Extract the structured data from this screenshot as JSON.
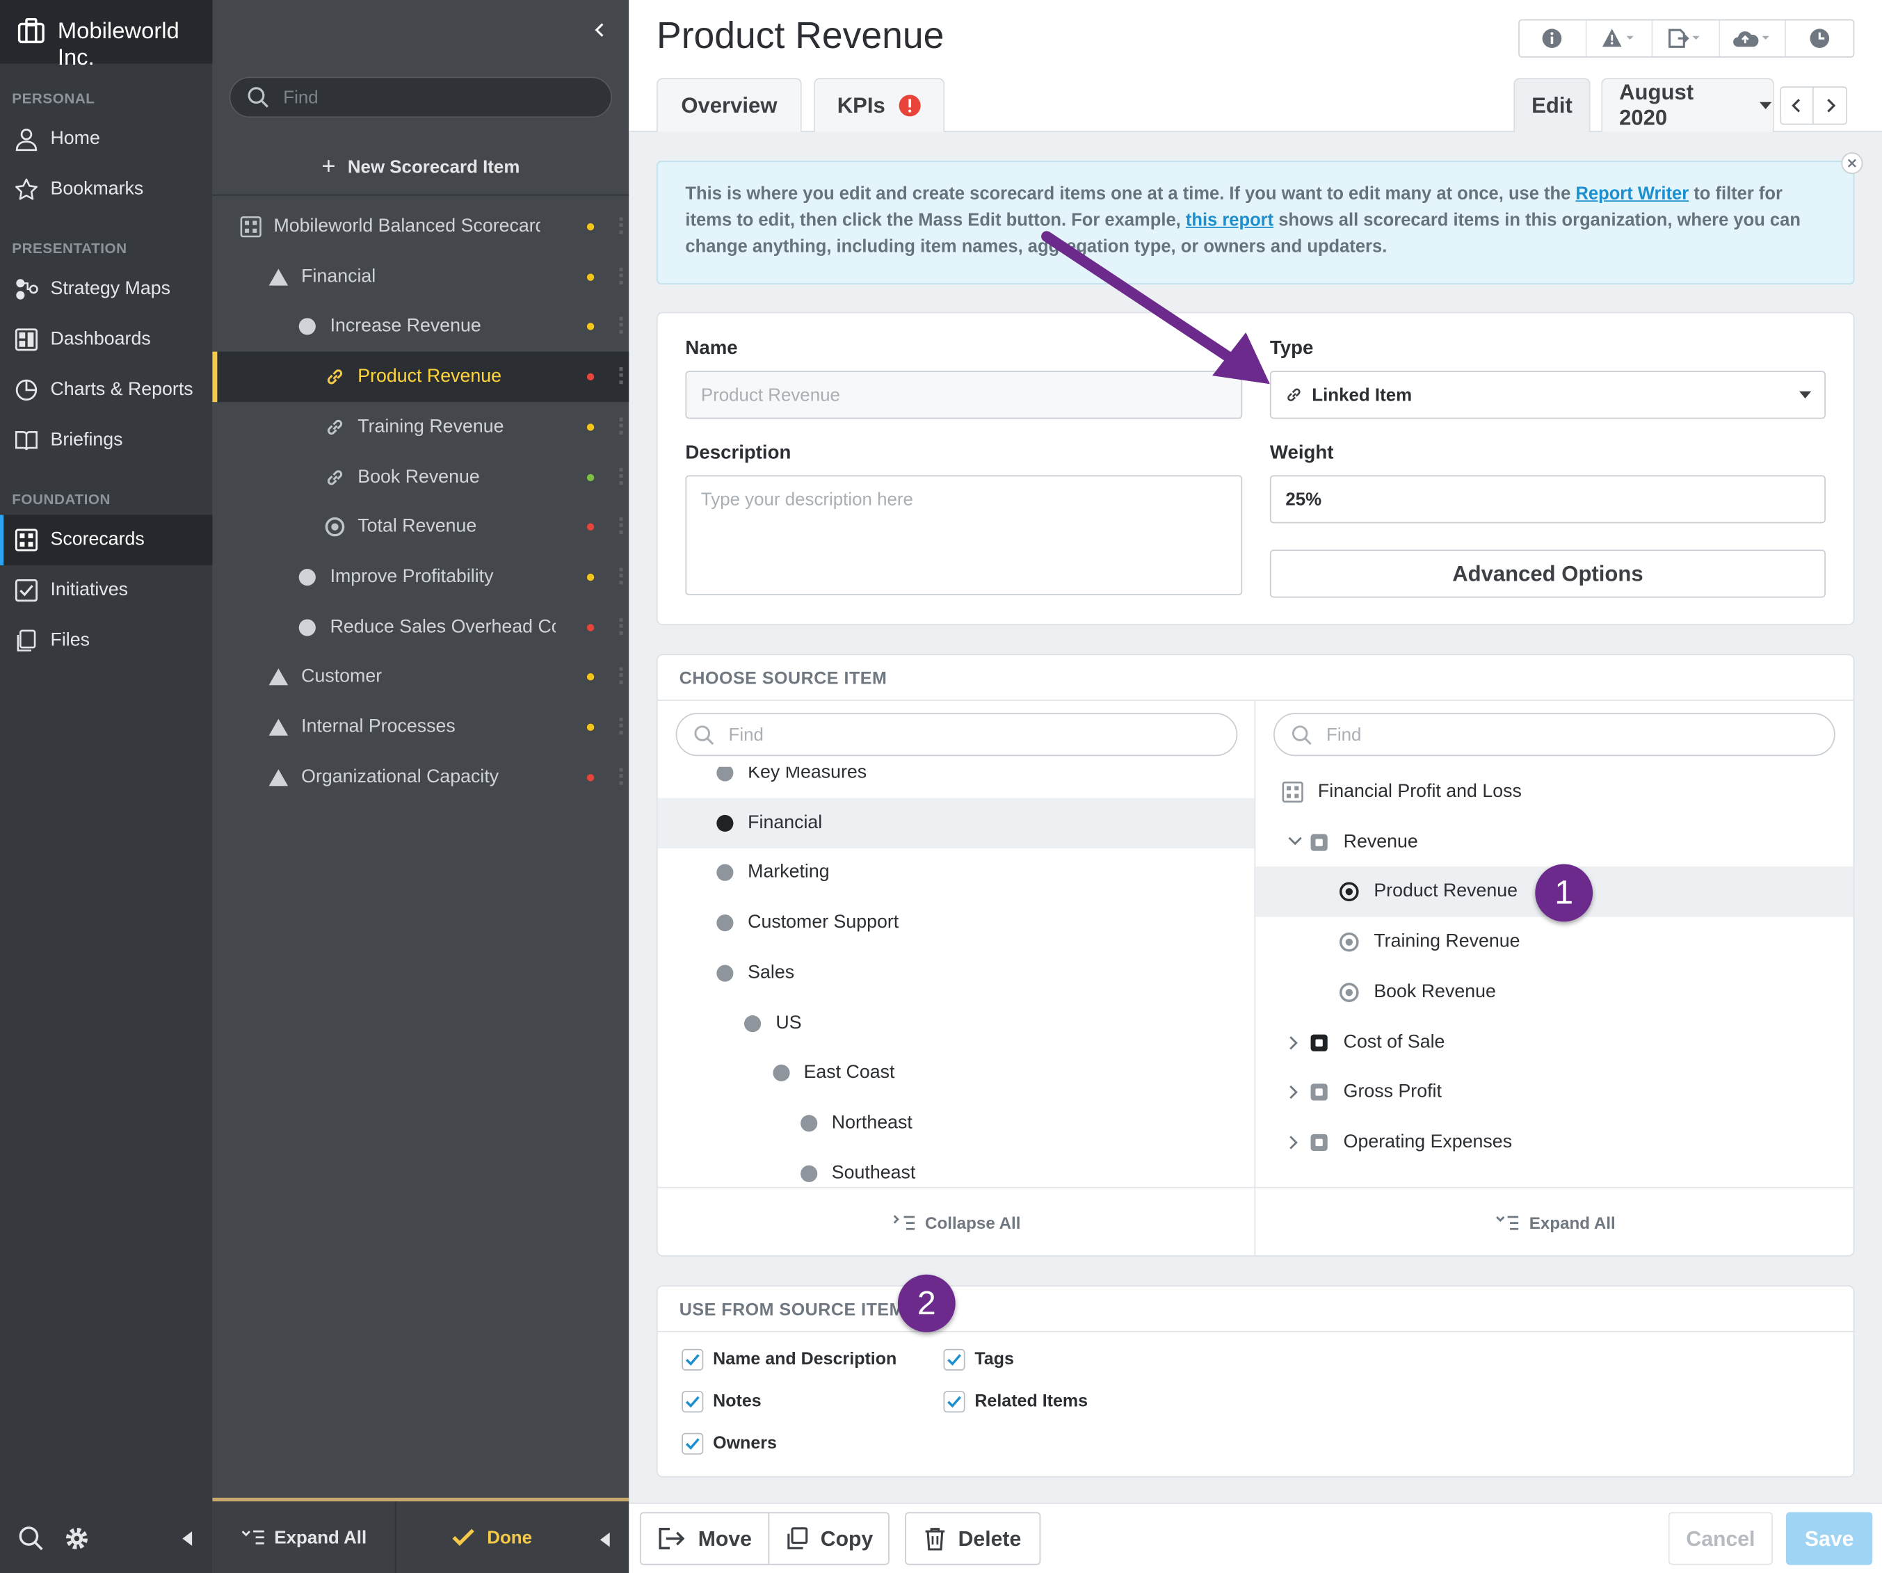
{
  "org": {
    "name": "Mobileworld Inc."
  },
  "nav": {
    "sections": [
      "PERSONAL",
      "PRESENTATION",
      "FOUNDATION"
    ],
    "items": [
      {
        "label": "Home",
        "icon": "user-icon"
      },
      {
        "label": "Bookmarks",
        "icon": "star-icon"
      },
      {
        "label": "Strategy Maps",
        "icon": "strategy-map-icon"
      },
      {
        "label": "Dashboards",
        "icon": "dashboard-icon"
      },
      {
        "label": "Charts & Reports",
        "icon": "pie-chart-icon"
      },
      {
        "label": "Briefings",
        "icon": "book-icon"
      },
      {
        "label": "Scorecards",
        "icon": "scorecard-icon",
        "active": true
      },
      {
        "label": "Initiatives",
        "icon": "checkbox-icon"
      },
      {
        "label": "Files",
        "icon": "files-icon"
      }
    ]
  },
  "tree": {
    "search_placeholder": "Find",
    "new_item": "New Scorecard Item",
    "rows": [
      {
        "label": "Mobileworld Balanced Scorecard",
        "icon": "scorecard-icon",
        "status": "#f5c518"
      },
      {
        "label": "Financial",
        "icon": "triangle-icon",
        "status": "#f5c518"
      },
      {
        "label": "Increase Revenue",
        "icon": "circle-icon",
        "status": "#f5c518"
      },
      {
        "label": "Product Revenue",
        "icon": "link-icon",
        "status": "#e8443a",
        "selected": true
      },
      {
        "label": "Training Revenue",
        "icon": "link-icon",
        "status": "#f5c518"
      },
      {
        "label": "Book Revenue",
        "icon": "link-icon",
        "status": "#7cc142"
      },
      {
        "label": "Total Revenue",
        "icon": "target-icon",
        "status": "#e8443a"
      },
      {
        "label": "Improve Profitability",
        "icon": "circle-icon",
        "status": "#f5c518"
      },
      {
        "label": "Reduce Sales Overhead Costs",
        "icon": "circle-icon",
        "status": "#e8443a"
      },
      {
        "label": "Customer",
        "icon": "triangle-icon",
        "status": "#f5c518"
      },
      {
        "label": "Internal Processes",
        "icon": "triangle-icon",
        "status": "#f5c518"
      },
      {
        "label": "Organizational Capacity",
        "icon": "triangle-icon",
        "status": "#e8443a"
      }
    ],
    "footer": {
      "expand_all": "Expand All",
      "done": "Done"
    }
  },
  "page": {
    "title": "Product Revenue",
    "tabs": {
      "overview": "Overview",
      "kpis": "KPIs",
      "edit": "Edit"
    },
    "period": "August 2020"
  },
  "info": {
    "text1": "This is where you edit and create scorecard items one at a time. If you want to edit many at once, use the ",
    "link1": "Report Writer",
    "text2": " to filter for items to edit, then click the Mass Edit button. For example, ",
    "link2": "this report",
    "text3": " shows all scorecard items in this organization, where you can change anything, including item names, aggregation type, or owners and updaters."
  },
  "form": {
    "name_label": "Name",
    "name_placeholder": "Product Revenue",
    "type_label": "Type",
    "type_value": "Linked Item",
    "description_label": "Description",
    "description_placeholder": "Type your description here",
    "weight_label": "Weight",
    "weight_value": "25%",
    "advanced": "Advanced Options"
  },
  "source": {
    "title": "CHOOSE SOURCE ITEM",
    "left_search": "Find",
    "right_search": "Find",
    "left_items": [
      {
        "label": "Key Measures",
        "indent": 0
      },
      {
        "label": "Financial",
        "indent": 0,
        "selected": true
      },
      {
        "label": "Marketing",
        "indent": 0
      },
      {
        "label": "Customer Support",
        "indent": 0
      },
      {
        "label": "Sales",
        "indent": 0
      },
      {
        "label": "US",
        "indent": 1
      },
      {
        "label": "East Coast",
        "indent": 2
      },
      {
        "label": "Northeast",
        "indent": 3
      },
      {
        "label": "Southeast",
        "indent": 3
      }
    ],
    "right_items": [
      {
        "label": "Financial Profit and Loss",
        "icon": "scorecard-icon",
        "indent": 0
      },
      {
        "label": "Revenue",
        "icon": "square-icon",
        "indent": 1,
        "expanded": true
      },
      {
        "label": "Product Revenue",
        "icon": "target-icon",
        "indent": 2,
        "selected": true
      },
      {
        "label": "Training Revenue",
        "icon": "target-icon",
        "indent": 2
      },
      {
        "label": "Book Revenue",
        "icon": "target-icon",
        "indent": 2
      },
      {
        "label": "Cost of Sale",
        "icon": "square-icon",
        "indent": 1,
        "collapsed": true
      },
      {
        "label": "Gross Profit",
        "icon": "square-icon",
        "indent": 1,
        "collapsed": true
      },
      {
        "label": "Operating Expenses",
        "icon": "square-icon",
        "indent": 1,
        "collapsed": true
      }
    ],
    "collapse_all": "Collapse All",
    "expand_all": "Expand All"
  },
  "use_from": {
    "title": "USE FROM SOURCE ITEM",
    "options": [
      "Name and Description",
      "Tags",
      "Notes",
      "Related Items",
      "Owners"
    ]
  },
  "callouts": [
    "1",
    "2"
  ],
  "actions": {
    "move": "Move",
    "copy": "Copy",
    "delete": "Delete",
    "cancel": "Cancel",
    "save": "Save"
  },
  "colors": {
    "accent": "#2ea3f2",
    "selected_yellow": "#f7c948",
    "callout_purple": "#6b2a8c",
    "info_bg": "#e4f4fb"
  }
}
